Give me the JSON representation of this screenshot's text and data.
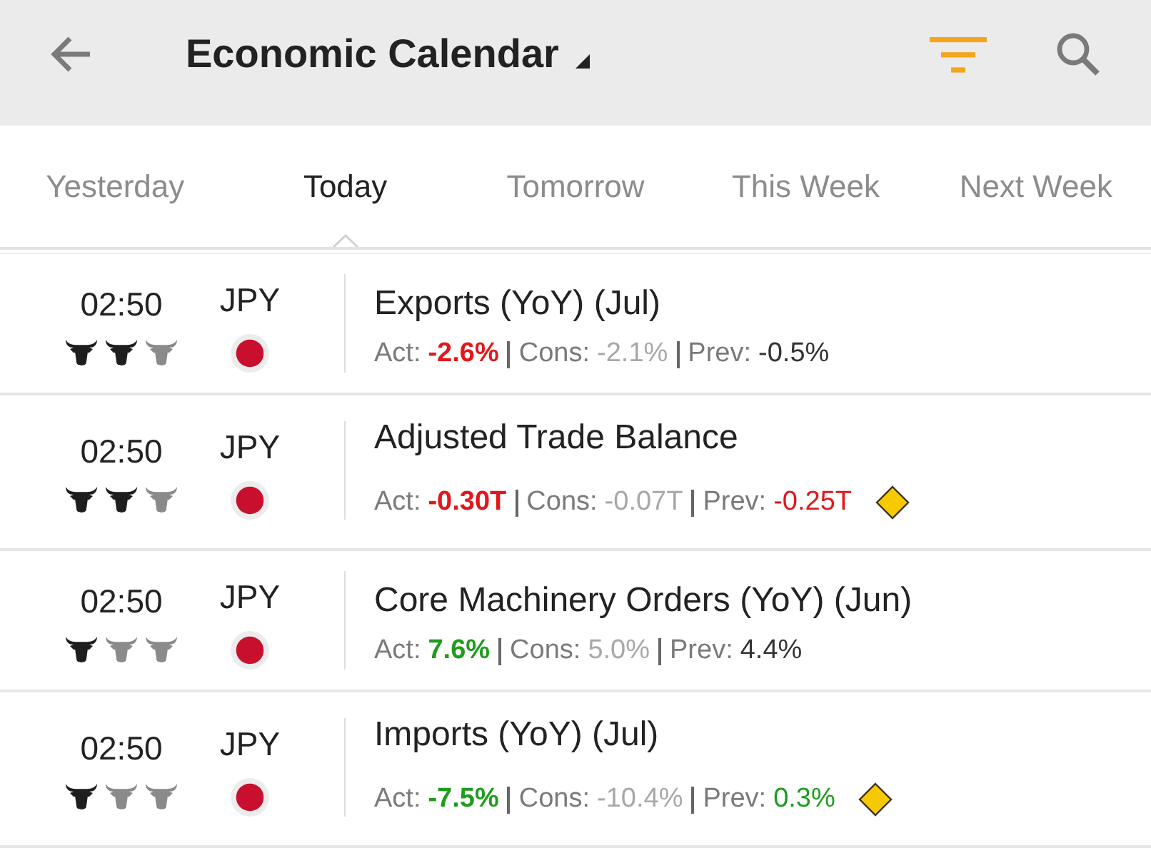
{
  "header": {
    "title": "Economic Calendar"
  },
  "tabs": [
    {
      "label": "Yesterday",
      "selected": false
    },
    {
      "label": "Today",
      "selected": true
    },
    {
      "label": "Tomorrow",
      "selected": false
    },
    {
      "label": "This Week",
      "selected": false
    },
    {
      "label": "Next Week",
      "selected": false
    }
  ],
  "events": [
    {
      "time": "02:50",
      "stars": 2,
      "currency": "JPY",
      "title": "Exports (YoY) (Jul)",
      "figures": [
        {
          "kind": "actual",
          "label": "Act:",
          "value": "-2.6%",
          "color": "#e5161b"
        },
        {
          "kind": "consensus",
          "label": "Cons:",
          "value": "-2.1%",
          "color": "#a8a8a8"
        },
        {
          "kind": "previous",
          "label": "Prev:",
          "value": "-0.5%",
          "color": "#333333"
        }
      ],
      "diamond_badge": false
    },
    {
      "time": "02:50",
      "stars": 2,
      "currency": "JPY",
      "title": "Adjusted Trade Balance",
      "figures": [
        {
          "kind": "actual",
          "label": "Act:",
          "value": "-0.30T",
          "color": "#e5161b"
        },
        {
          "kind": "consensus",
          "label": "Cons:",
          "value": "-0.07T",
          "color": "#a8a8a8"
        },
        {
          "kind": "previous",
          "label": "Prev:",
          "value": "-0.25T",
          "color": "#e5161b"
        }
      ],
      "diamond_badge": true
    },
    {
      "time": "02:50",
      "stars": 1,
      "currency": "JPY",
      "title": "Core Machinery Orders (YoY) (Jun)",
      "figures": [
        {
          "kind": "actual",
          "label": "Act:",
          "value": "7.6%",
          "color": "#1e9c1e"
        },
        {
          "kind": "consensus",
          "label": "Cons:",
          "value": "5.0%",
          "color": "#a8a8a8"
        },
        {
          "kind": "previous",
          "label": "Prev:",
          "value": "4.4%",
          "color": "#333333"
        }
      ],
      "diamond_badge": false
    },
    {
      "time": "02:50",
      "stars": 1,
      "currency": "JPY",
      "title": "Imports (YoY) (Jul)",
      "figures": [
        {
          "kind": "actual",
          "label": "Act:",
          "value": "-7.5%",
          "color": "#1e9c1e"
        },
        {
          "kind": "consensus",
          "label": "Cons:",
          "value": "-10.4%",
          "color": "#a8a8a8"
        },
        {
          "kind": "previous",
          "label": "Prev:",
          "value": "0.3%",
          "color": "#1e9c1e"
        }
      ],
      "diamond_badge": true
    }
  ]
}
